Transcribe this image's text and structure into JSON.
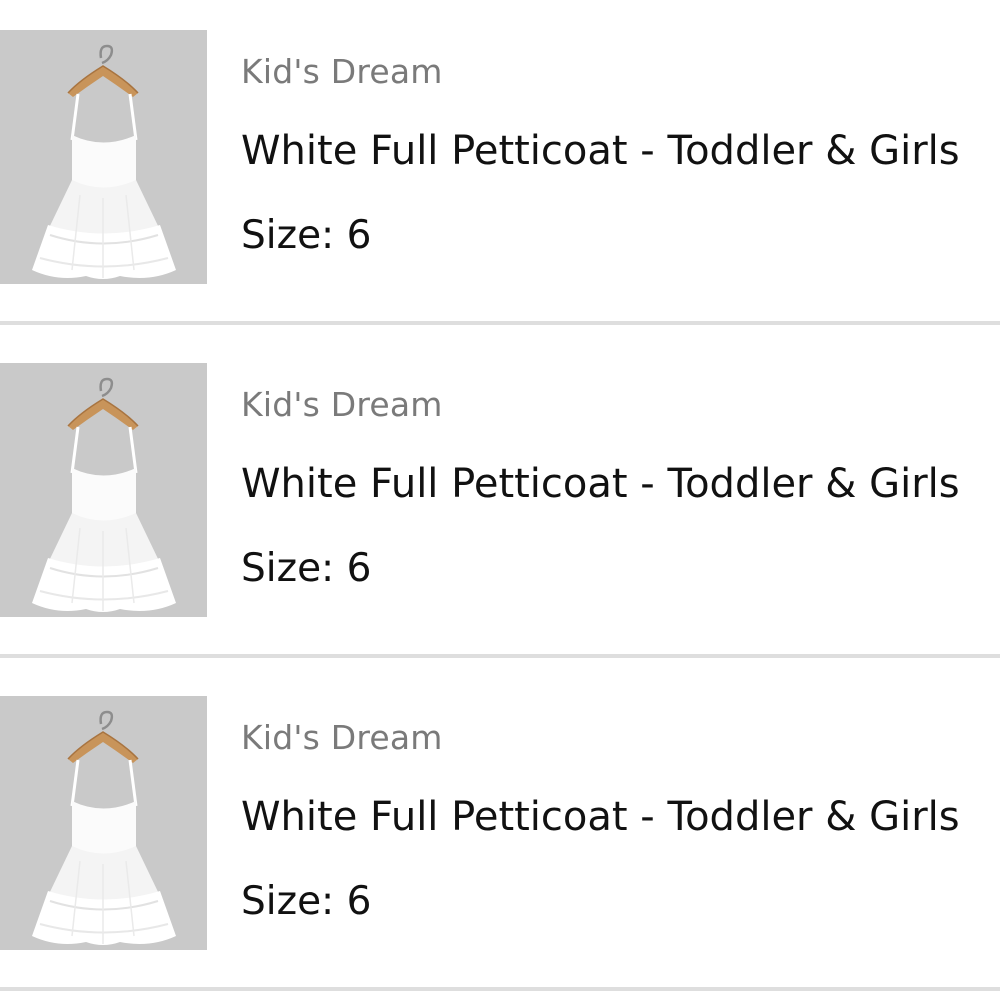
{
  "cart_items": [
    {
      "brand": "Kid's Dream",
      "title": "White Full Petticoat - Toddler & Girls",
      "size": "Size: 6",
      "image_icon": "petticoat-dress-on-hanger"
    },
    {
      "brand": "Kid's Dream",
      "title": "White Full Petticoat - Toddler & Girls",
      "size": "Size: 6",
      "image_icon": "petticoat-dress-on-hanger"
    },
    {
      "brand": "Kid's Dream",
      "title": "White Full Petticoat - Toddler & Girls",
      "size": "Size: 6",
      "image_icon": "petticoat-dress-on-hanger"
    }
  ],
  "colors": {
    "thumb_background": "#c9c9c9",
    "brand_text": "#7a7a7a",
    "title_text": "#111111",
    "divider": "#dedede"
  }
}
